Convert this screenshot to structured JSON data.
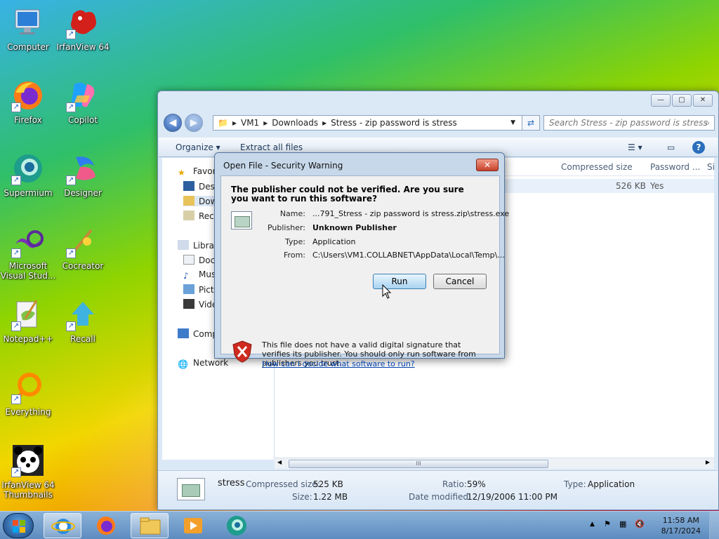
{
  "desktop": {
    "icons": [
      {
        "label": "Computer"
      },
      {
        "label": "IrfanView 64"
      },
      {
        "label": "Firefox"
      },
      {
        "label": "Copilot"
      },
      {
        "label": "Supermium"
      },
      {
        "label": "Designer"
      },
      {
        "label": "Microsoft Visual Stud..."
      },
      {
        "label": "Cocreator"
      },
      {
        "label": "Notepad++"
      },
      {
        "label": "Recall"
      },
      {
        "label": "Everything"
      },
      {
        "label": "IrfanView 64 Thumbnails"
      }
    ]
  },
  "explorer": {
    "caption_buttons": {
      "minimize": "—",
      "maximize": "▢",
      "close": "✕"
    },
    "breadcrumb": [
      "VM1",
      "Downloads",
      "Stress - zip password is stress"
    ],
    "search_placeholder": "Search Stress - zip password is stress",
    "toolbar": {
      "organize": "Organize",
      "extract": "Extract all files"
    },
    "nav": {
      "favorites": "Favori",
      "desktop": "Desk",
      "downloads": "Dow",
      "recent": "Rece",
      "libraries": "Librari",
      "documents": "Doc",
      "music": "Mus",
      "pictures": "Pict",
      "videos": "Vide",
      "computer": "Comp",
      "network": "Network"
    },
    "columns": {
      "compressed": "Compressed size",
      "password": "Password ...",
      "size": "Si"
    },
    "row": {
      "compressed": "526 KB",
      "password": "Yes"
    },
    "scroll_grip": "III",
    "details": {
      "name": "stress",
      "compressed_label": "Compressed size:",
      "compressed_value": "525 KB",
      "size_label": "Size:",
      "size_value": "1.22 MB",
      "ratio_label": "Ratio:",
      "ratio_value": "59%",
      "modified_label": "Date modified:",
      "modified_value": "12/19/2006 11:00 PM",
      "type_label": "Type:",
      "type_value": "Application"
    }
  },
  "dialog": {
    "title": "Open File - Security Warning",
    "close": "✕",
    "question": "The publisher could not be verified.  Are you sure you want to run this software?",
    "name_label": "Name:",
    "name_value": "...791_Stress - zip password is stress.zip\\stress.exe",
    "publisher_label": "Publisher:",
    "publisher_value": "Unknown Publisher",
    "type_label": "Type:",
    "type_value": "Application",
    "from_label": "From:",
    "from_value": "C:\\Users\\VM1.COLLABNET\\AppData\\Local\\Temp\\...",
    "run": "Run",
    "cancel": "Cancel",
    "warning": "This file does not have a valid digital signature that verifies its publisher.  You should only run software from publishers you trust.",
    "help_link": "How can I decide what software to run?"
  },
  "taskbar": {
    "time": "11:58 AM",
    "date": "8/17/2024"
  }
}
